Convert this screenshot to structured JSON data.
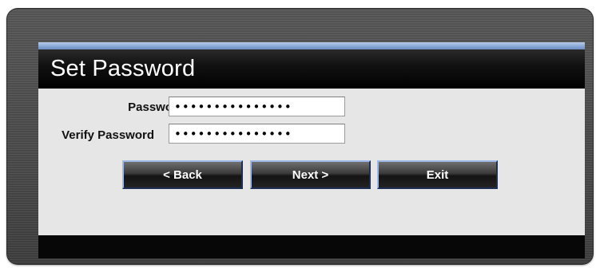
{
  "dialog": {
    "title": "Set Password",
    "password_label": "Password",
    "password_value": "•••••••••••••••",
    "verify_label": "Verify Password",
    "verify_value": "•••••••••••••••",
    "buttons": {
      "back": "< Back",
      "next": "Next >",
      "exit": "Exit"
    }
  },
  "colors": {
    "accent_bar": "#8aa8d6",
    "header_bg": "#000000",
    "body_bg": "#e6e6e6",
    "frame_bg": "#4a4a4a"
  }
}
